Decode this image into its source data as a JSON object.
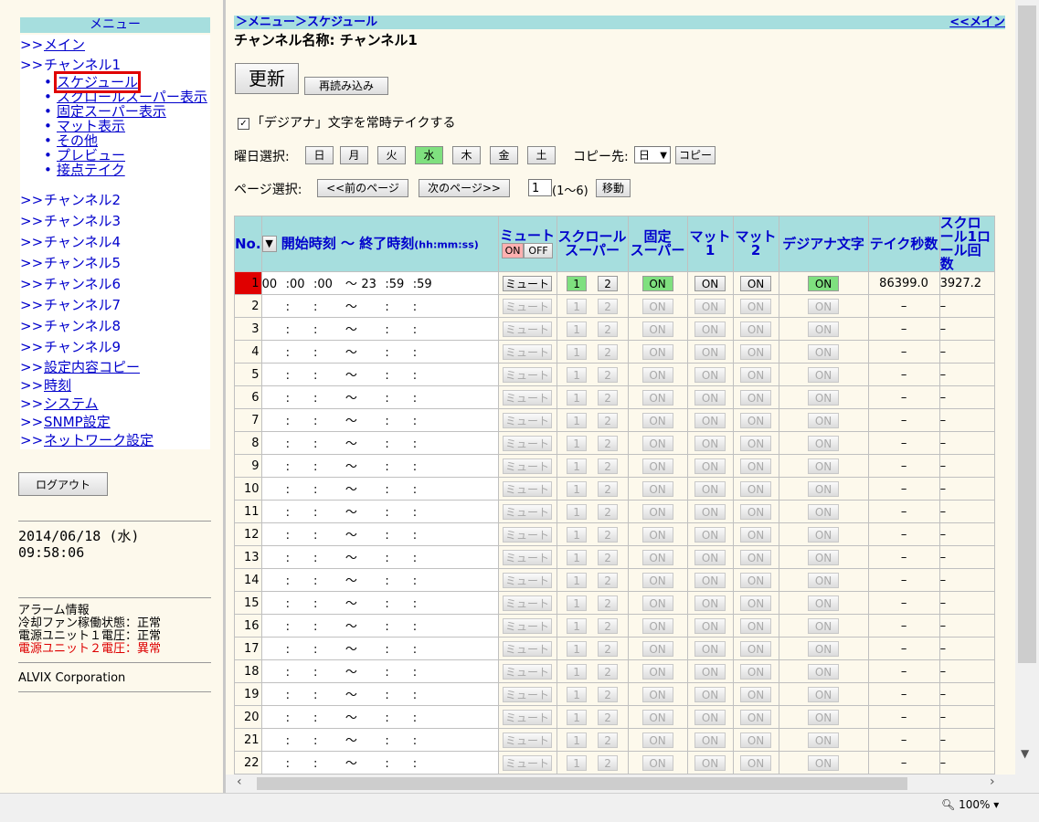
{
  "menu": {
    "title": "メニュー",
    "arrow": ">>",
    "bullet": "•",
    "main_link": "メイン",
    "channel1": "チャンネル1",
    "sub_items": [
      "スケジュール",
      "スクロールスーパー表示",
      "固定スーパー表示",
      "マット表示",
      "その他",
      "プレビュー",
      "接点テイク"
    ],
    "channels": [
      "チャンネル2",
      "チャンネル3",
      "チャンネル4",
      "チャンネル5",
      "チャンネル6",
      "チャンネル7",
      "チャンネル8",
      "チャンネル9"
    ],
    "links": [
      "設定内容コピー",
      "時刻",
      "システム",
      "SNMP設定",
      "ネットワーク設定"
    ],
    "logout": "ログアウト",
    "datetime_date": "2014/06/18 (水)",
    "datetime_time": "09:58:06",
    "alarm_title": "アラーム情報",
    "alarm_fan": "冷却ファン稼働状態：正常",
    "alarm_psu1": "電源ユニット１電圧：正常",
    "alarm_psu2": "電源ユニット２電圧：異常",
    "corp": "ALVIX Corporation"
  },
  "main": {
    "breadcrumb": "＞メニュー＞スケジュール",
    "back_link": "<<メイン",
    "channel_name": "チャンネル名称: チャンネル1",
    "update_btn": "更新",
    "reload_btn": "再読み込み",
    "check_label": "「デジアナ」文字を常時テイクする",
    "check_mark": "✓",
    "day_label": "曜日選択:",
    "days": [
      "日",
      "月",
      "火",
      "水",
      "木",
      "金",
      "土"
    ],
    "selected_day_color": "#7fe07f",
    "copy_label": "コピー先:",
    "copy_value": "日",
    "copy_btn": "コピー",
    "page_label": "ページ選択:",
    "prev_btn": "<<前のページ",
    "next_btn": "次のページ>>",
    "page_value": "1",
    "page_range": "(1〜6)",
    "move_btn": "移動"
  },
  "table": {
    "headers": {
      "no": "No.",
      "time": "開始時刻 〜 終了時刻",
      "time_unit": "(hh:mm:ss)",
      "sort_icon": "▼",
      "mute": "ミュート",
      "mute_on": "ON",
      "mute_off": "OFF",
      "scroll": "スクロール\nスーパー",
      "fixed": "固定\nスーパー",
      "mat1": "マット1",
      "mat2": "マット2",
      "digiana": "デジアナ文字",
      "take_sec": "テイク秒数",
      "scroll_count": "スクロール1ロール回数"
    },
    "button_labels": {
      "mute": "ミュート",
      "s1": "1",
      "s2": "2",
      "on": "ON"
    },
    "first_row": {
      "start": [
        "00",
        "00",
        "00"
      ],
      "end": [
        "23",
        "59",
        "59"
      ],
      "take_sec": "86399.0",
      "roll": "3927.2"
    },
    "time_sep": ":",
    "tilde": "〜",
    "dash": "–",
    "row_count": 22
  },
  "status": {
    "zoom": "100%"
  }
}
